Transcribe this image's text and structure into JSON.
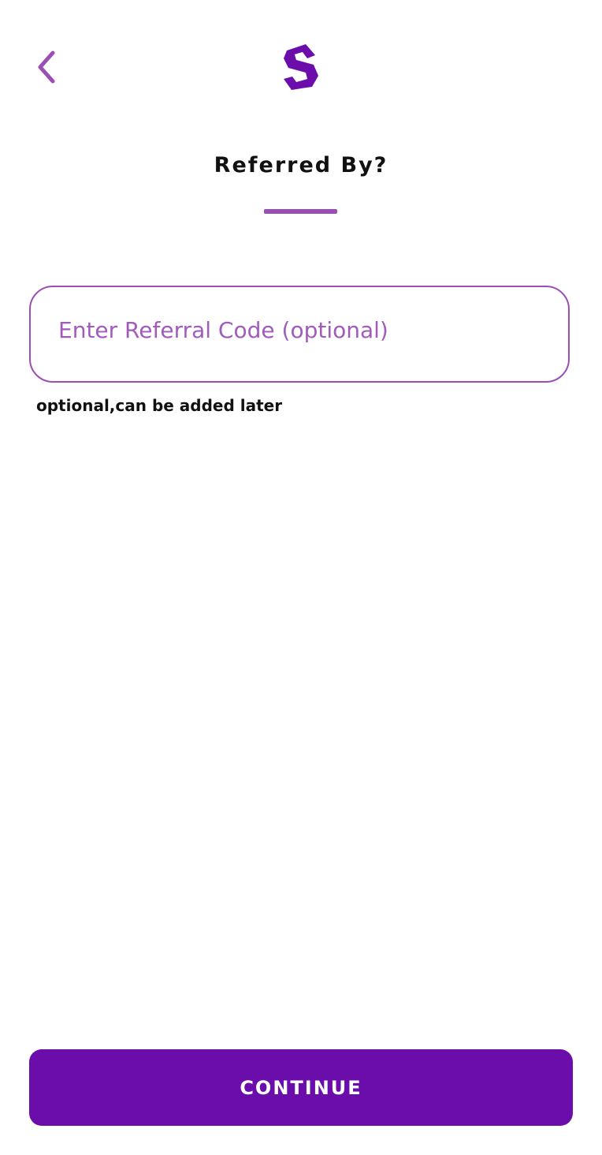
{
  "header": {
    "back_icon": "chevron-left-icon",
    "logo_icon": "brand-s-logo-icon",
    "title": "Referred By?"
  },
  "form": {
    "referral_input": {
      "placeholder": "Enter Referral Code (optional)",
      "value": ""
    },
    "helper_text": "optional,can be added later"
  },
  "footer": {
    "continue_label": "CONTINUE"
  },
  "colors": {
    "accent": "#9b4fb5",
    "primary_button": "#6a0dab",
    "logo": "#6a0dab",
    "text": "#111111",
    "background": "#ffffff"
  }
}
